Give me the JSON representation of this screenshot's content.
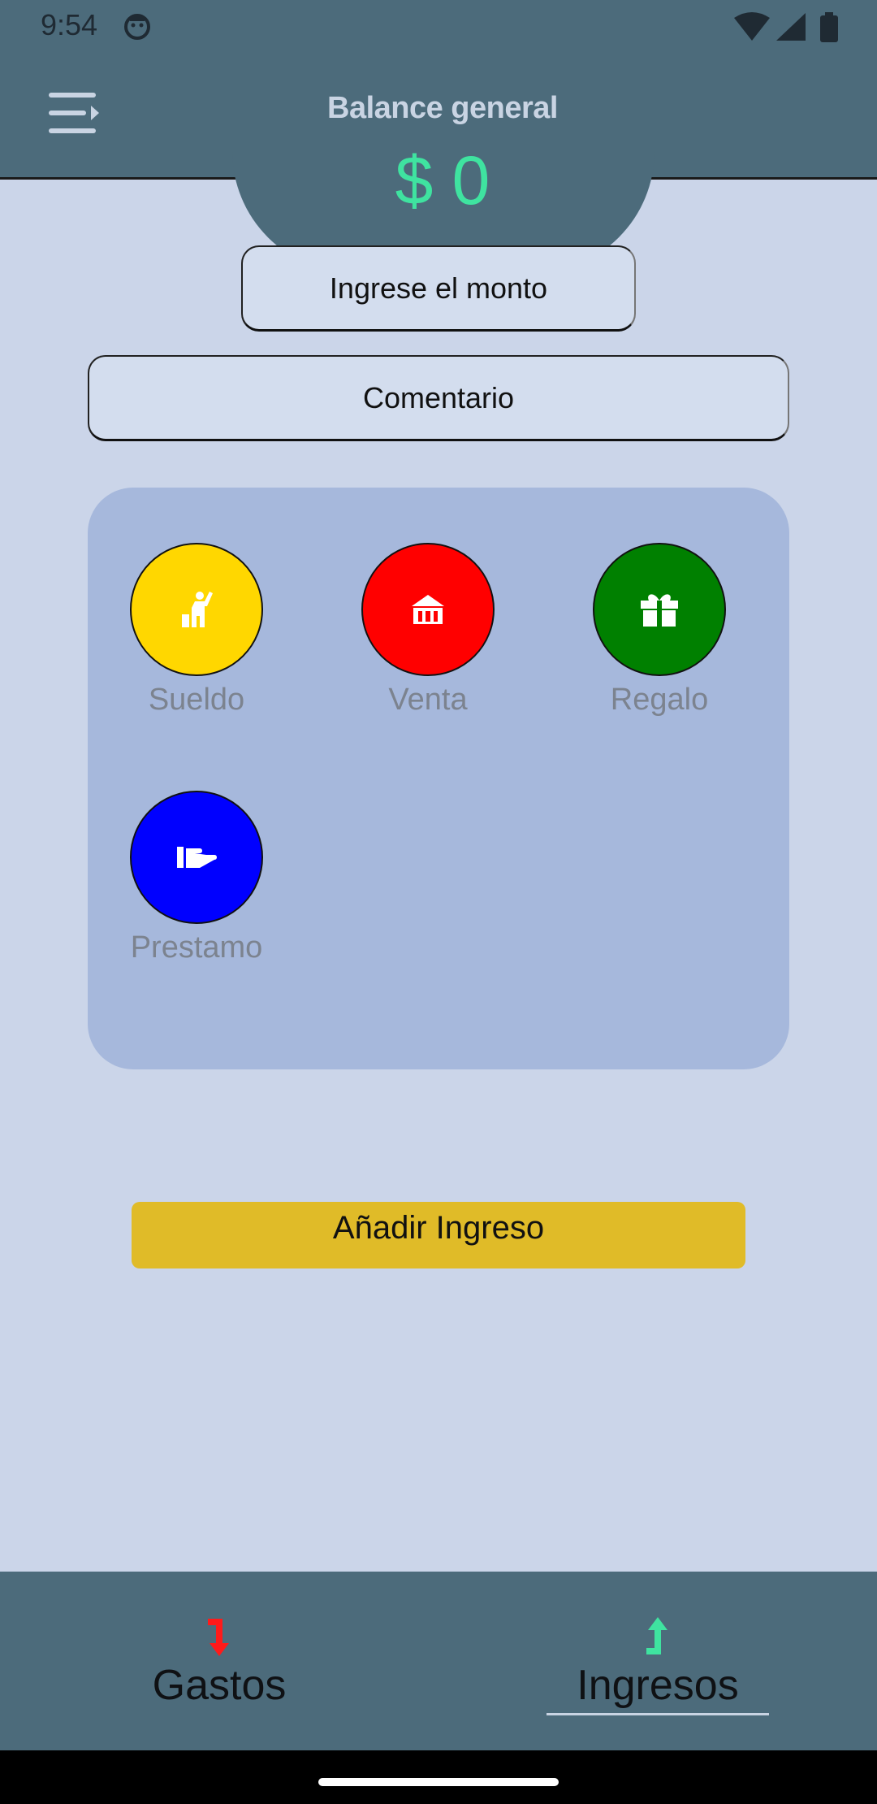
{
  "status_bar": {
    "time": "9:54"
  },
  "header": {
    "title": "Balance general",
    "balance": "$ 0"
  },
  "form": {
    "amount_placeholder": "Ingrese el monto",
    "comment_placeholder": "Comentario"
  },
  "categories": [
    {
      "label": "Sueldo",
      "color": "#ffd700",
      "icon": "person-raising-hand-icon"
    },
    {
      "label": "Venta",
      "color": "#ff0000",
      "icon": "shop-icon"
    },
    {
      "label": "Regalo",
      "color": "#008000",
      "icon": "gift-icon"
    },
    {
      "label": "Prestamo",
      "color": "#0000ff",
      "icon": "hand-holding-icon"
    }
  ],
  "add_button": {
    "label": "Añadir Ingreso",
    "color": "#e0bb28"
  },
  "bottom_nav": {
    "tabs": [
      {
        "label": "Gastos",
        "icon": "arrow-down-red-icon",
        "selected": false
      },
      {
        "label": "Ingresos",
        "icon": "arrow-up-green-icon",
        "selected": true
      }
    ]
  },
  "colors": {
    "header": "#4c6b7b",
    "background": "#cbd5e9",
    "balance": "#3fe3a0"
  }
}
